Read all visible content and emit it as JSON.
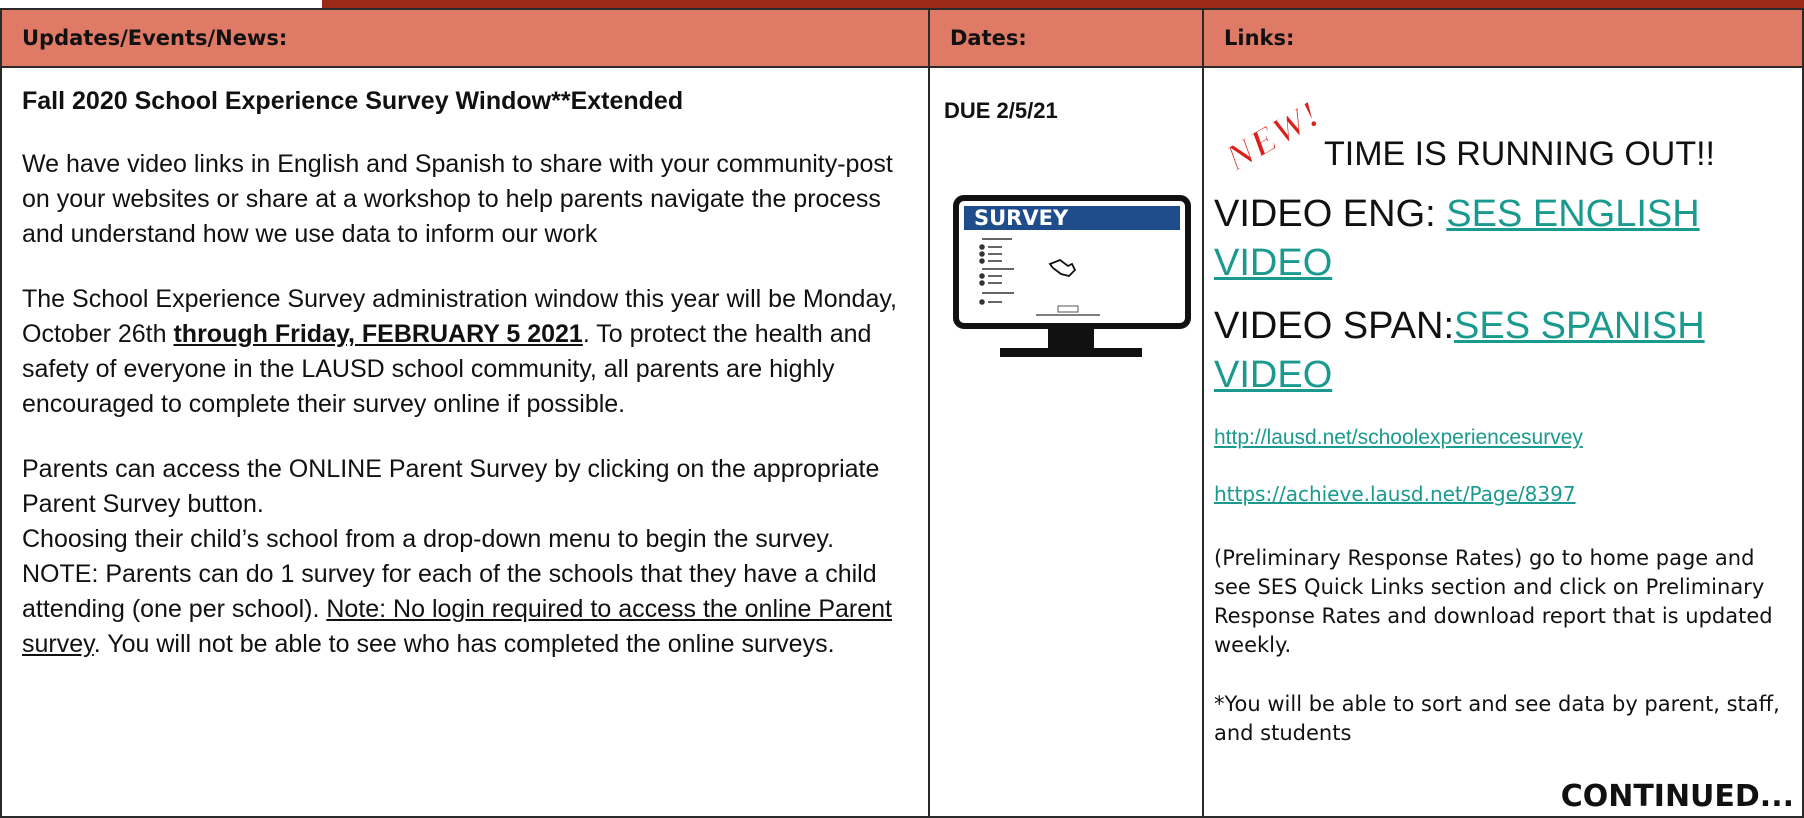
{
  "header": {
    "col1": "Updates/Events/News:",
    "col2": "Dates:",
    "col3": "Links:"
  },
  "left": {
    "title": "Fall 2020 School Experience Survey Window**Extended",
    "para1": "We have video links in English and Spanish to share with your community-post on your websites or share at a workshop to help parents navigate the process and understand how we use data to inform our work",
    "para2_a": "The School Experience Survey administration window this year will be Monday, October 26th ",
    "para2_bold": "through Friday, FEBRUARY 5 2021",
    "para2_b": ".  To protect the health and safety of everyone in the LAUSD school community, all parents are highly encouraged to complete their survey online if possible.",
    "para3_a": "Parents can access the ONLINE Parent Survey by clicking on the appropriate Parent Survey button.",
    "para3_b": "Choosing their child’s school from a drop-down menu to begin the survey. NOTE:  Parents can do 1 survey for each of the schools that they have a child attending (one per school). ",
    "para3_underline": "Note: No login required to access the online Parent survey",
    "para3_c": ".  You will not be able to see who has completed the online surveys."
  },
  "dates": {
    "due": "DUE 2/5/21",
    "monitor_label": "SURVEY"
  },
  "links": {
    "new_badge": "NEW!",
    "headline": "TIME IS RUNNING OUT!!",
    "video_eng_label": "VIDEO ENG: ",
    "video_eng_link": "SES ENGLISH VIDEO",
    "video_span_label": "VIDEO SPAN:",
    "video_span_link": "SES SPANISH VIDEO",
    "url1": "http://lausd.net/schoolexperiencesurvey",
    "url2": "https://achieve.lausd.net/Page/8397",
    "note1": "(Preliminary Response Rates)  go to home page and see SES Quick Links section and click on Preliminary Response Rates and download report that is updated weekly.",
    "note2": "*You will be able to sort and see data by parent, staff, and students",
    "continued": "CONTINUED..."
  },
  "colors": {
    "header_bg": "#df7a67",
    "top_bar": "#9b2a1a",
    "link": "#1a9a8e",
    "monitor_band": "#1f4d8c",
    "badge_fill": "#d9201b"
  },
  "icons": [
    "new-badge-icon",
    "survey-monitor-icon",
    "pointing-hand-icon"
  ]
}
